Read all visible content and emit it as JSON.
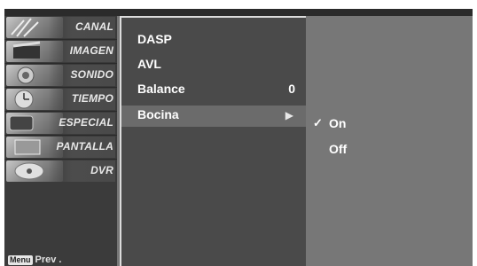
{
  "sidebar": {
    "items": [
      {
        "label": "CANAL",
        "icon": "satellite-dish-icon"
      },
      {
        "label": "IMAGEN",
        "icon": "film-clapper-icon"
      },
      {
        "label": "SONIDO",
        "icon": "speaker-icon"
      },
      {
        "label": "TIEMPO",
        "icon": "clock-icon"
      },
      {
        "label": "ESPECIAL",
        "icon": "special-tag-icon"
      },
      {
        "label": "PANTALLA",
        "icon": "screen-icon"
      },
      {
        "label": "DVR",
        "icon": "disc-icon"
      }
    ],
    "prev_key": "Menu",
    "prev_label": "Prev ."
  },
  "menu": {
    "items": [
      {
        "label": "DASP",
        "value": ""
      },
      {
        "label": "AVL",
        "value": ""
      },
      {
        "label": "Balance",
        "value": "0"
      },
      {
        "label": "Bocina",
        "value": "",
        "arrow": "▶",
        "selected": true
      }
    ]
  },
  "submenu": {
    "items": [
      {
        "label": "On",
        "checked": true,
        "check": "✓"
      },
      {
        "label": "Off",
        "checked": false
      }
    ]
  },
  "colors": {
    "background": "#777777",
    "panel": "#4a4a4a",
    "highlight": "#6b6b6b",
    "sidebar": "#3b3b3b"
  }
}
